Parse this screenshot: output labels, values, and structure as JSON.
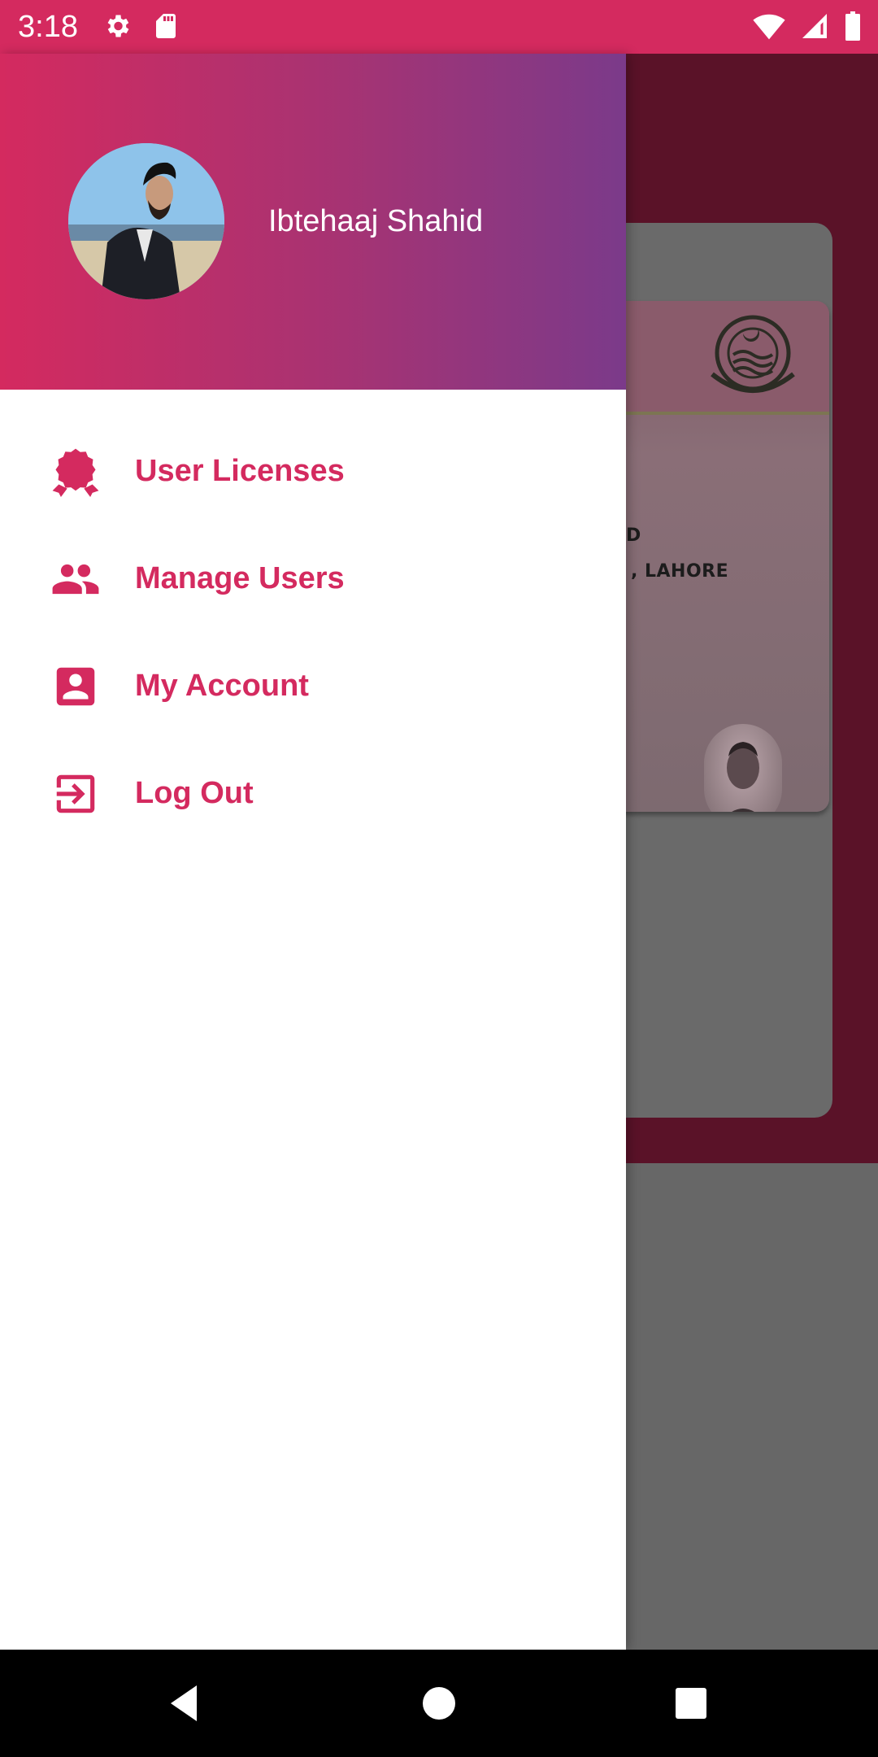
{
  "status_bar": {
    "time": "3:18",
    "left_icons": [
      "gear-icon",
      "sd-card-icon"
    ],
    "right_icons": [
      "wifi-icon",
      "signal-icon",
      "battery-icon"
    ],
    "background_color": "#d42a5f"
  },
  "drawer": {
    "header": {
      "user_name": "Ibtehaaj Shahid",
      "gradient_colors": [
        "#d42a5f",
        "#7b3a8a"
      ]
    },
    "menu_items": [
      {
        "label": "User Licenses",
        "icon": "badge-icon"
      },
      {
        "label": "Manage Users",
        "icon": "people-icon"
      },
      {
        "label": "My Account",
        "icon": "account-box-icon"
      },
      {
        "label": "Log Out",
        "icon": "logout-icon"
      }
    ],
    "accent_color": "#d42a5f"
  },
  "background": {
    "license_card": {
      "line_1": "D",
      "line_2": ", LAHORE"
    }
  },
  "nav_bar": {
    "buttons": [
      "back-icon",
      "home-icon",
      "recents-icon"
    ]
  }
}
